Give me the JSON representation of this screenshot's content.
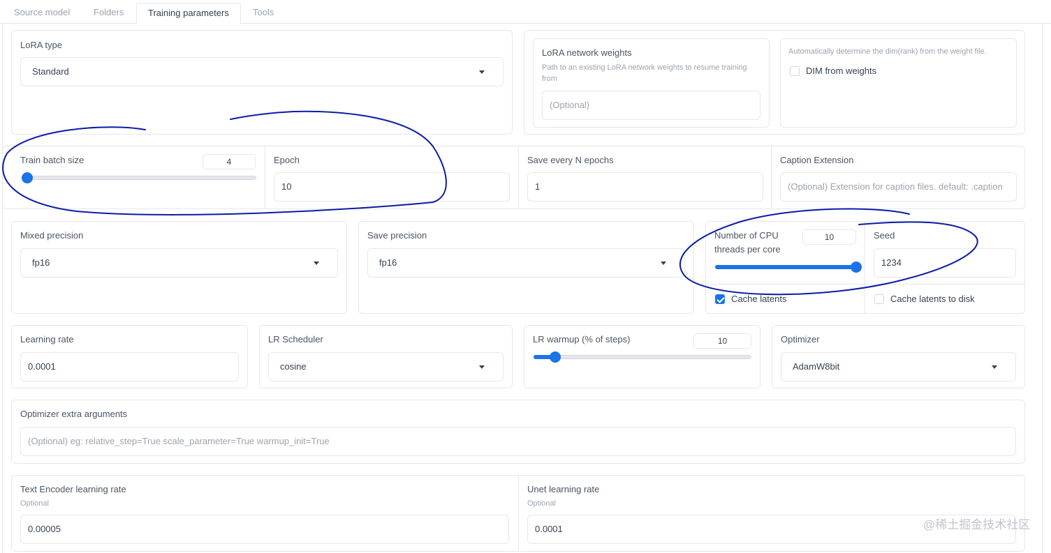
{
  "tabs": [
    {
      "label": "Source model"
    },
    {
      "label": "Folders"
    },
    {
      "label": "Training parameters"
    },
    {
      "label": "Tools"
    }
  ],
  "lora_type": {
    "label": "LoRA type",
    "value": "Standard"
  },
  "network_weights": {
    "label": "LoRA network weights",
    "info": "Path to an existing LoRA network weights to resume training from",
    "placeholder": "(Optional)"
  },
  "dim_from_weights": {
    "info": "Automatically determine the dim(rank) from the weight file.",
    "label": "DIM from weights",
    "checked": false
  },
  "train_batch_size": {
    "label": "Train batch size",
    "value": "4",
    "fraction": 0.02
  },
  "epoch": {
    "label": "Epoch",
    "value": "10"
  },
  "save_every": {
    "label": "Save every N epochs",
    "value": "1"
  },
  "caption_ext": {
    "label": "Caption Extension",
    "placeholder": "(Optional) Extension for caption files. default: .caption"
  },
  "mixed_precision": {
    "label": "Mixed precision",
    "value": "fp16"
  },
  "save_precision": {
    "label": "Save precision",
    "value": "fp16"
  },
  "cpu_threads": {
    "label_line1": "Number of CPU",
    "label_line2": "threads per core",
    "value": "10",
    "fraction": 1.0
  },
  "seed": {
    "label": "Seed",
    "value": "1234"
  },
  "cache_latents": {
    "label": "Cache latents",
    "checked": true
  },
  "cache_latents_disk": {
    "label": "Cache latents to disk",
    "checked": false
  },
  "learning_rate": {
    "label": "Learning rate",
    "value": "0.0001"
  },
  "lr_scheduler": {
    "label": "LR Scheduler",
    "value": "cosine"
  },
  "lr_warmup": {
    "label": "LR warmup (% of steps)",
    "value": "10",
    "fraction": 0.1
  },
  "optimizer": {
    "label": "Optimizer",
    "value": "AdamW8bit"
  },
  "optimizer_args": {
    "label": "Optimizer extra arguments",
    "placeholder": "(Optional) eg: relative_step=True scale_parameter=True warmup_init=True"
  },
  "text_encoder_lr": {
    "label": "Text Encoder learning rate",
    "sub": "Optional",
    "value": "0.00005"
  },
  "unet_lr": {
    "label": "Unet learning rate",
    "sub": "Optional",
    "value": "0.0001"
  },
  "watermark": "@稀土掘金技术社区",
  "colors": {
    "accent": "#1a73e8",
    "annotation": "#0a1aa8"
  }
}
